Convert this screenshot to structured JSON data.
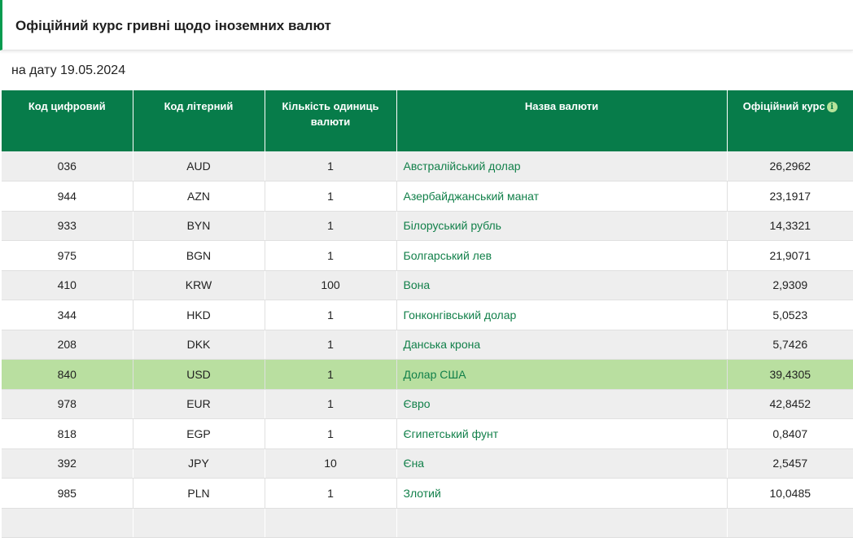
{
  "page": {
    "title": "Офіційний курс гривні щодо іноземних валют",
    "date_line": "на дату 19.05.2024"
  },
  "table": {
    "headers": {
      "code_digital": "Код цифровий",
      "code_letter": "Код літерний",
      "units": "Кількість одиниць валюти",
      "name": "Назва валюти",
      "rate": "Офіційний курс"
    },
    "info_icon": "info-icon",
    "rows": [
      {
        "code": "036",
        "letter": "AUD",
        "units": "1",
        "name": "Австралійський долар",
        "rate": "26,2962"
      },
      {
        "code": "944",
        "letter": "AZN",
        "units": "1",
        "name": "Азербайджанський манат",
        "rate": "23,1917"
      },
      {
        "code": "933",
        "letter": "BYN",
        "units": "1",
        "name": "Білоруський рубль",
        "rate": "14,3321"
      },
      {
        "code": "975",
        "letter": "BGN",
        "units": "1",
        "name": "Болгарський лев",
        "rate": "21,9071"
      },
      {
        "code": "410",
        "letter": "KRW",
        "units": "100",
        "name": "Вона",
        "rate": "2,9309"
      },
      {
        "code": "344",
        "letter": "HKD",
        "units": "1",
        "name": "Гонконгівський долар",
        "rate": "5,0523"
      },
      {
        "code": "208",
        "letter": "DKK",
        "units": "1",
        "name": "Данська крона",
        "rate": "5,7426"
      },
      {
        "code": "840",
        "letter": "USD",
        "units": "1",
        "name": "Долар США",
        "rate": "39,4305",
        "highlight": true
      },
      {
        "code": "978",
        "letter": "EUR",
        "units": "1",
        "name": "Євро",
        "rate": "42,8452"
      },
      {
        "code": "818",
        "letter": "EGP",
        "units": "1",
        "name": "Єгипетський фунт",
        "rate": "0,8407"
      },
      {
        "code": "392",
        "letter": "JPY",
        "units": "10",
        "name": "Єна",
        "rate": "2,5457"
      },
      {
        "code": "985",
        "letter": "PLN",
        "units": "1",
        "name": "Злотий",
        "rate": "10,0485"
      },
      {
        "code": "",
        "letter": "",
        "units": "",
        "name": "",
        "rate": ""
      }
    ]
  },
  "colors": {
    "header_bg": "#077c4a",
    "accent": "#079b4f",
    "link": "#12804a",
    "highlight_row": "#b9dfa0",
    "stripe": "#eeeeee"
  }
}
